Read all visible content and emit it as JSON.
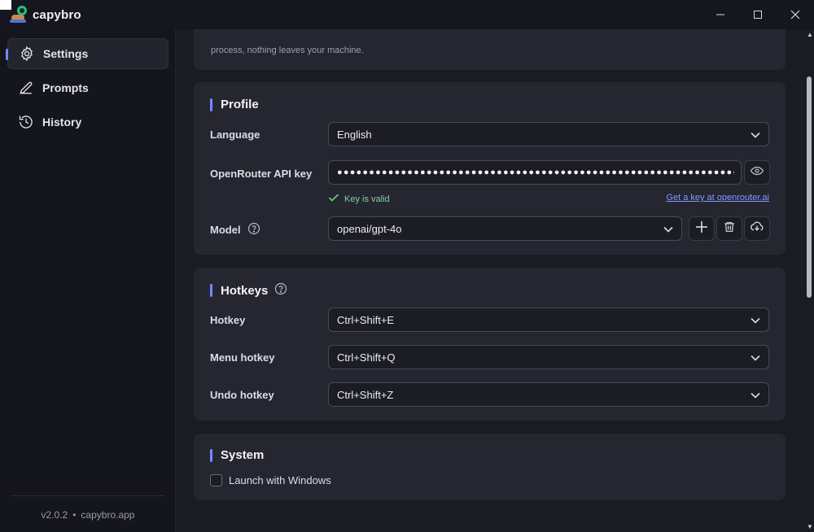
{
  "app": {
    "name": "capybro"
  },
  "window": {
    "minimize": "—",
    "maximize": "☐",
    "close": "✕"
  },
  "sidebar": {
    "items": [
      {
        "label": "Settings",
        "icon": "gear-icon",
        "active": true
      },
      {
        "label": "Prompts",
        "icon": "pencil-icon",
        "active": false
      },
      {
        "label": "History",
        "icon": "history-icon",
        "active": false
      }
    ],
    "footer": {
      "version": "v2.0.2",
      "separator": "•",
      "site": "capybro.app"
    }
  },
  "top_card": {
    "text": "process, nothing leaves your machine."
  },
  "profile": {
    "title": "Profile",
    "language_label": "Language",
    "language_value": "English",
    "api_key_label": "OpenRouter API key",
    "api_key_value": "●●●●●●●●●●●●●●●●●●●●●●●●●●●●●●●●●●●●●●●●●●●●●●●●●●●●●●●●●●●●●●●●",
    "key_status": "Key is valid",
    "get_key_link": "Get a key at openrouter.ai",
    "model_label": "Model",
    "model_value": "openai/gpt-4o"
  },
  "hotkeys": {
    "title": "Hotkeys",
    "hotkey_label": "Hotkey",
    "hotkey_value": "Ctrl+Shift+E",
    "menu_hotkey_label": "Menu hotkey",
    "menu_hotkey_value": "Ctrl+Shift+Q",
    "undo_hotkey_label": "Undo hotkey",
    "undo_hotkey_value": "Ctrl+Shift+Z"
  },
  "system": {
    "title": "System",
    "launch_label": "Launch with Windows"
  },
  "colors": {
    "accent": "#6e8bff",
    "valid": "#4fd17a",
    "link": "#7c9cff"
  }
}
